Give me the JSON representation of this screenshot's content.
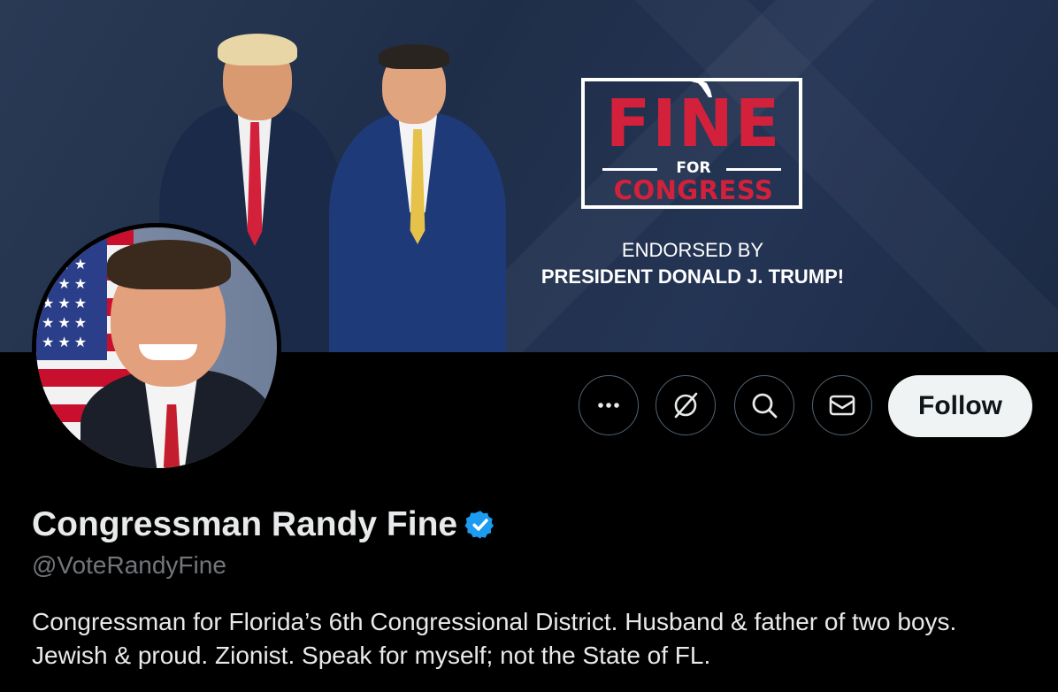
{
  "banner": {
    "logo_fine": "FINE",
    "logo_for": "FOR",
    "logo_congress": "CONGRESS",
    "endorsed_line1": "ENDORSED BY",
    "endorsed_line2": "PRESIDENT DONALD J. TRUMP!",
    "accent_color": "#d3213b"
  },
  "actions": {
    "more_icon": "more-horizontal-icon",
    "grok_icon": "grok-icon",
    "search_icon": "search-icon",
    "message_icon": "envelope-icon",
    "follow_label": "Follow"
  },
  "profile": {
    "display_name": "Congressman Randy Fine",
    "verified_icon": "verified-badge-icon",
    "verified_color": "#1d9bf0",
    "handle": "@VoteRandyFine",
    "bio": "Congressman for Florida’s 6th Congressional District. Husband & father of two boys. Jewish & proud. Zionist. Speak for myself; not the State of FL."
  }
}
